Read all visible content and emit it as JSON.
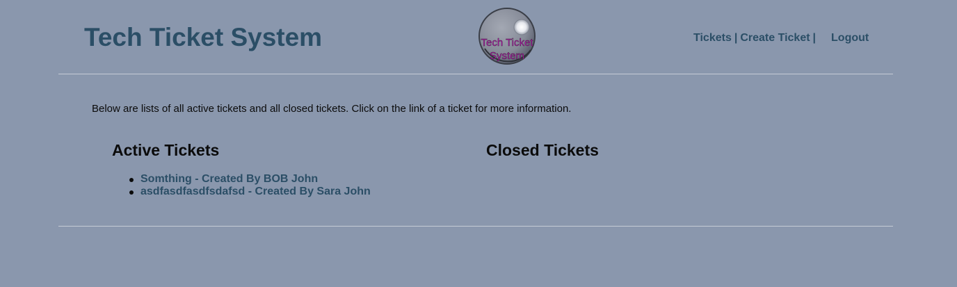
{
  "header": {
    "title": "Tech Ticket System",
    "logo_text_line1": "Tech Ticket",
    "logo_text_line2": "System"
  },
  "nav": {
    "tickets": "Tickets",
    "separator1": "|",
    "create_ticket": "Create Ticket",
    "separator2": "|",
    "logout": "Logout"
  },
  "main": {
    "intro": "Below are lists of all active tickets and all closed tickets. Click on the link of a ticket for more information.",
    "active_heading": "Active Tickets",
    "closed_heading": "Closed Tickets",
    "active_tickets": [
      {
        "label": "Somthing - Created By BOB John"
      },
      {
        "label": "asdfasdfasdfsdafsd - Created By Sara John"
      }
    ]
  },
  "colors": {
    "background": "#8a97ad",
    "link": "#2b4e66",
    "text": "#0b0b0b",
    "logo_text": "#b01aa8"
  }
}
